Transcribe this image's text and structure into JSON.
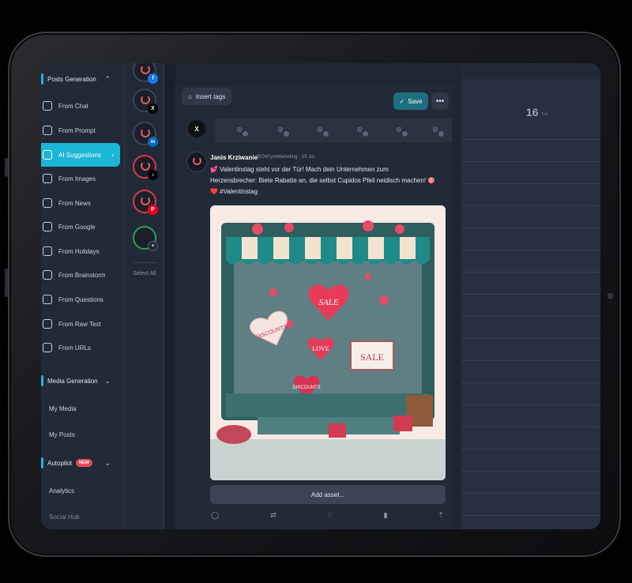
{
  "sidebar": {
    "posts_generation": "Posts Generation",
    "items": [
      {
        "label": "From Chat",
        "icon": "chat-icon"
      },
      {
        "label": "From Prompt",
        "icon": "prompt-icon"
      },
      {
        "label": "AI Suggestions",
        "icon": "ai-icon",
        "active": true
      },
      {
        "label": "From Images",
        "icon": "image-icon"
      },
      {
        "label": "From News",
        "icon": "news-icon"
      },
      {
        "label": "From Google",
        "icon": "google-icon"
      },
      {
        "label": "From Holidays",
        "icon": "calendar-icon"
      },
      {
        "label": "From Brainstorm",
        "icon": "brain-icon"
      },
      {
        "label": "From Questions",
        "icon": "question-icon"
      },
      {
        "label": "From Raw Text",
        "icon": "text-icon"
      },
      {
        "label": "From URLs",
        "icon": "link-icon"
      }
    ],
    "media_generation": "Media Generation",
    "my_media": "My Media",
    "my_posts": "My Posts",
    "autopilot": "Autopilot",
    "new_badge": "NEW",
    "analytics": "Analytics",
    "social_hub": "Social Hub"
  },
  "accounts": {
    "networks": [
      "f",
      "X",
      "in",
      "♪",
      "P",
      "+"
    ],
    "select_all": "Select All"
  },
  "toolbar": {
    "insert_tags": "Insert tags",
    "save": "Save",
    "more": "•••"
  },
  "post": {
    "author": "Janis Krziwanie",
    "handle": "@OnFyreMarketing · 19 Jul.",
    "text_line1": "💕 Valentinstag steht vor der Tür! Mach dein Unternehmen zum",
    "text_line2": "Herzensbrecher: Biete Rabatte an, die selbst Cupidos Pfeil neidisch machen! 🎯",
    "text_line3": "❤️ #Valentinstag",
    "image_signs": [
      "SALE",
      "DISCOUNTS",
      "LOVE",
      "SALE",
      "DISCOUNTS"
    ],
    "add_asset": "Add asset..."
  },
  "calendar": {
    "day": "16",
    "day_sub": "Tue"
  },
  "colors": {
    "accent": "#1cb6d6",
    "save": "#1d6f7f",
    "background": "#1f2633"
  }
}
